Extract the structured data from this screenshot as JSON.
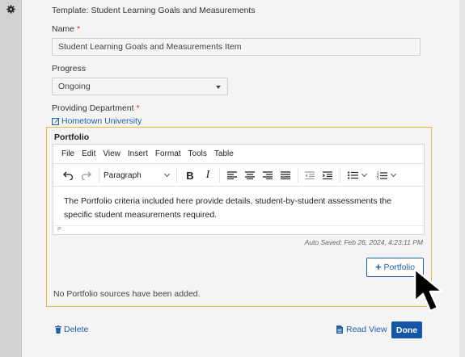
{
  "template": {
    "label": "Template:",
    "value": "Student Learning Goals and Measurements"
  },
  "name": {
    "label": "Name",
    "required_mark": "*",
    "value": "Student Learning Goals and Measurements Item"
  },
  "progress": {
    "label": "Progress",
    "value": "Ongoing"
  },
  "providing_department": {
    "label": "Providing Department",
    "required_mark": "*",
    "link_text": "Hometown University"
  },
  "portfolio": {
    "title": "Portfolio",
    "menu": [
      "File",
      "Edit",
      "View",
      "Insert",
      "Format",
      "Tools",
      "Table"
    ],
    "block_format": "Paragraph",
    "content": "The Portfolio criteria included here provide details, student-by-student assessments the specific student measurements required.",
    "status_path": "P",
    "auto_saved": "Auto Saved: Feb 26, 2024, 4:23:11 PM",
    "add_button_label": "Portfolio",
    "empty_message": "No Portfolio sources have been added."
  },
  "footer": {
    "delete_label": "Delete",
    "read_view_label": "Read View",
    "done_label": "Done"
  },
  "colors": {
    "accent": "#1557a6",
    "link": "#1e5fa8",
    "focus_border": "#e8b840",
    "required": "#c0392b"
  },
  "icons": [
    "gear-icon",
    "edit-icon",
    "undo-icon",
    "redo-icon",
    "bold-icon",
    "italic-icon",
    "align-left-icon",
    "align-center-icon",
    "align-right-icon",
    "justify-icon",
    "outdent-icon",
    "indent-icon",
    "bullet-list-icon",
    "numbered-list-icon",
    "plus-icon",
    "trash-icon",
    "document-icon",
    "mouse-pointer-icon"
  ]
}
